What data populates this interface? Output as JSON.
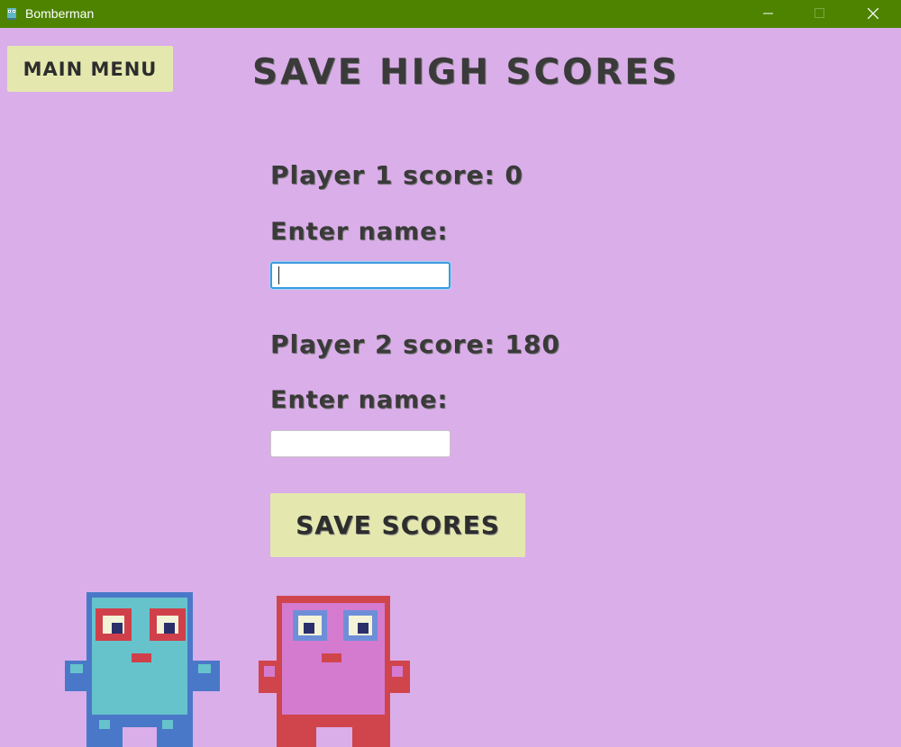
{
  "window": {
    "title": "Bomberman",
    "icon": "bomberman-app-icon",
    "controls": [
      "minimize-icon",
      "maximize-icon",
      "close-icon"
    ],
    "titlebar_color": "#4e8300"
  },
  "colors": {
    "background": "#daaee9",
    "button": "#e4e8ae",
    "text": "#3a3a3a",
    "focus": "#3c9ae0"
  },
  "nav": {
    "main_menu_label": "Main Menu"
  },
  "page": {
    "title": "Save High Scores"
  },
  "player1": {
    "score_text": "Player 1 score: 0",
    "name_label": "Enter name:",
    "name_value": ""
  },
  "player2": {
    "score_text": "Player 2 score: 180",
    "name_label": "Enter name:",
    "name_value": ""
  },
  "actions": {
    "save_label": "Save Scores"
  },
  "characters": [
    "blue-monster-sprite",
    "pink-monster-sprite"
  ]
}
